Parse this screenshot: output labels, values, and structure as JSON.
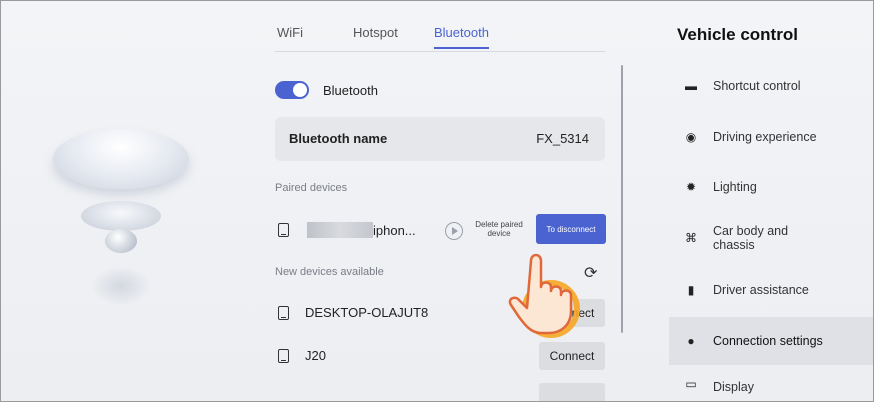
{
  "tabs": [
    "WiFi",
    "Hotspot",
    "Bluetooth"
  ],
  "active_tab": "Bluetooth",
  "bluetooth": {
    "toggle_label": "Bluetooth",
    "toggle_on": true,
    "name_key": "Bluetooth name",
    "name_value": "FX_5314"
  },
  "paired": {
    "section_label": "Paired devices",
    "device_name": "iphon...",
    "delete_label": "Delete paired device",
    "disconnect_label": "To disconnect"
  },
  "available": {
    "section_label": "New devices available",
    "devices": [
      {
        "name": "DESKTOP-OLAJUT8",
        "button": "Connect"
      },
      {
        "name": "J20",
        "button": "Connect"
      }
    ]
  },
  "right_panel": {
    "title": "Vehicle control",
    "items": [
      {
        "label": "Shortcut control",
        "icon": "car-icon"
      },
      {
        "label": "Driving experience",
        "icon": "steering-wheel-icon"
      },
      {
        "label": "Lighting",
        "icon": "light-icon"
      },
      {
        "label": "Car body and chassis",
        "icon": "chassis-icon"
      },
      {
        "label": "Driver assistance",
        "icon": "driver-assist-icon"
      },
      {
        "label": "Connection settings",
        "icon": "connection-icon",
        "active": true
      },
      {
        "label": "Display",
        "icon": "display-icon"
      }
    ]
  },
  "colors": {
    "accent": "#4a63d0",
    "card": "#e6e7ea",
    "active_row": "#dfe1e6"
  }
}
